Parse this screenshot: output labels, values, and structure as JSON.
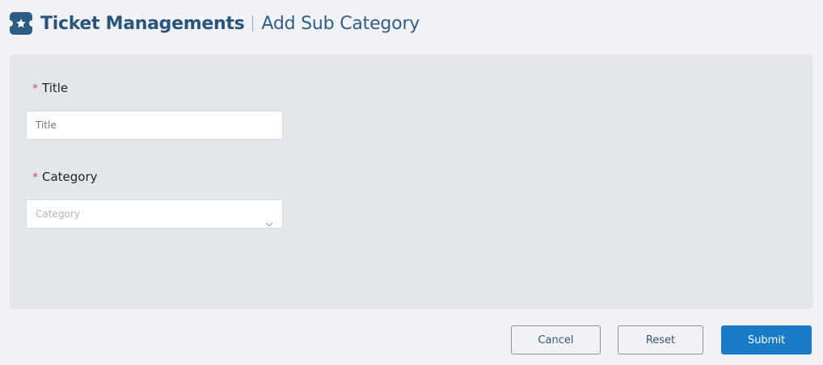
{
  "header": {
    "app_title": "Ticket Managements",
    "page_title": "Add Sub Category",
    "logo_icon": "ticket-star-icon"
  },
  "form": {
    "title_field": {
      "required_mark": "*",
      "label": "Title",
      "placeholder": "Title",
      "value": ""
    },
    "category_field": {
      "required_mark": "*",
      "label": "Category",
      "placeholder": "Category",
      "selected": ""
    }
  },
  "actions": {
    "cancel_label": "Cancel",
    "reset_label": "Reset",
    "submit_label": "Submit"
  },
  "colors": {
    "brand": "#27557d",
    "primary": "#1a7bc8",
    "required": "#e0463c",
    "panel": "#e3e7eb",
    "page_bg": "#f0f2f6"
  }
}
